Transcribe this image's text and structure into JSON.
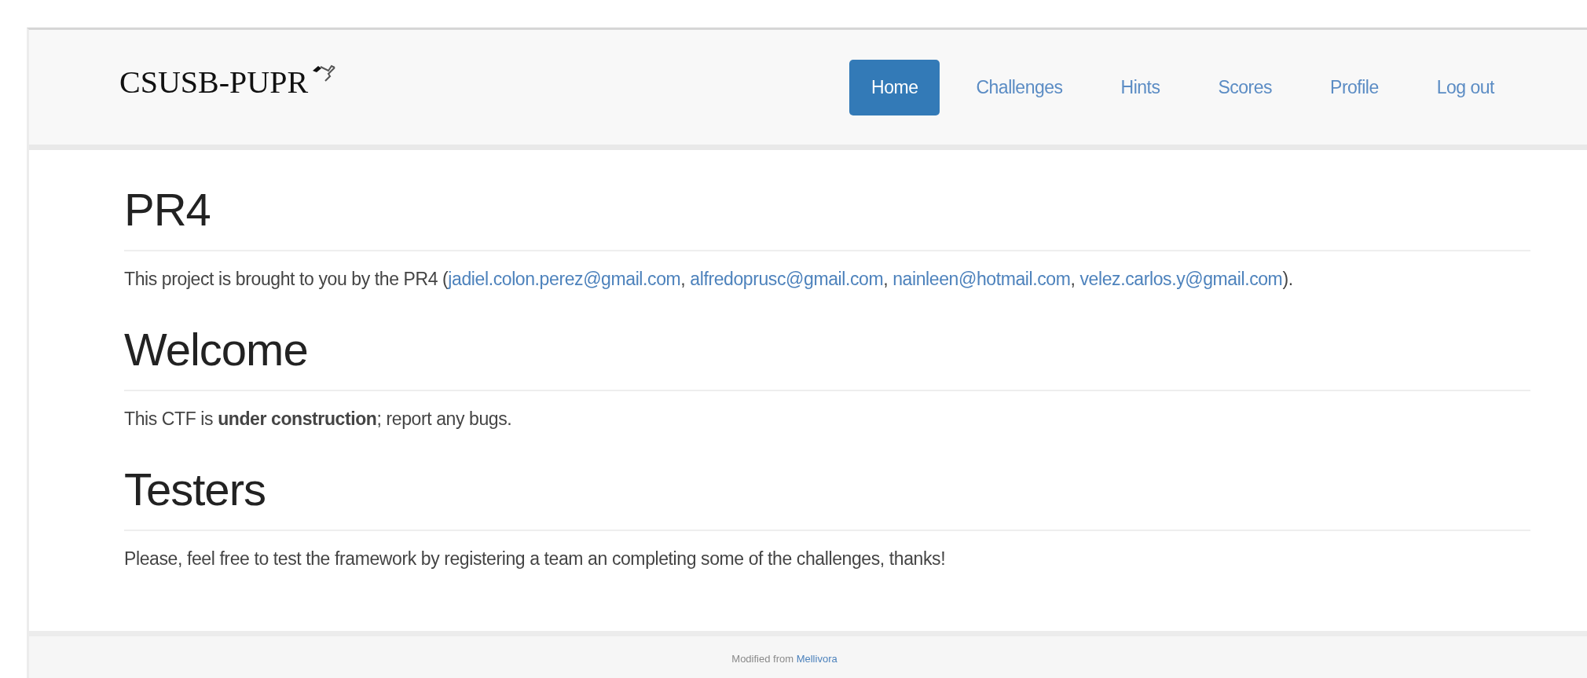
{
  "brand": "CSUSB-PUPR",
  "nav": [
    {
      "label": "Home",
      "selected": true
    },
    {
      "label": "Challenges",
      "selected": false
    },
    {
      "label": "Hints",
      "selected": false
    },
    {
      "label": "Scores",
      "selected": false
    },
    {
      "label": "Profile",
      "selected": false
    },
    {
      "label": "Log out",
      "selected": false
    }
  ],
  "sections": [
    {
      "heading": "PR4",
      "parts": [
        {
          "kind": "text",
          "text": "This project is brought to you by the PR4 ("
        },
        {
          "kind": "link",
          "text": "jadiel.colon.perez@gmail.com"
        },
        {
          "kind": "text",
          "text": ", "
        },
        {
          "kind": "link",
          "text": "alfredoprusc@gmail.com"
        },
        {
          "kind": "text",
          "text": ", "
        },
        {
          "kind": "link",
          "text": "nainleen@hotmail.com"
        },
        {
          "kind": "text",
          "text": ", "
        },
        {
          "kind": "link",
          "text": "velez.carlos.y@gmail.com"
        },
        {
          "kind": "text",
          "text": ")."
        }
      ]
    },
    {
      "heading": "Welcome",
      "parts": [
        {
          "kind": "text",
          "text": "This CTF is **under construction**; report any bugs."
        }
      ]
    },
    {
      "heading": "Testers",
      "parts": [
        {
          "kind": "text",
          "text": "Please, feel free to test the framework by registering a team an completing some of the challenges, thanks!"
        }
      ]
    }
  ],
  "footer": {
    "text": "Modified from ",
    "link": "Mellivora"
  }
}
